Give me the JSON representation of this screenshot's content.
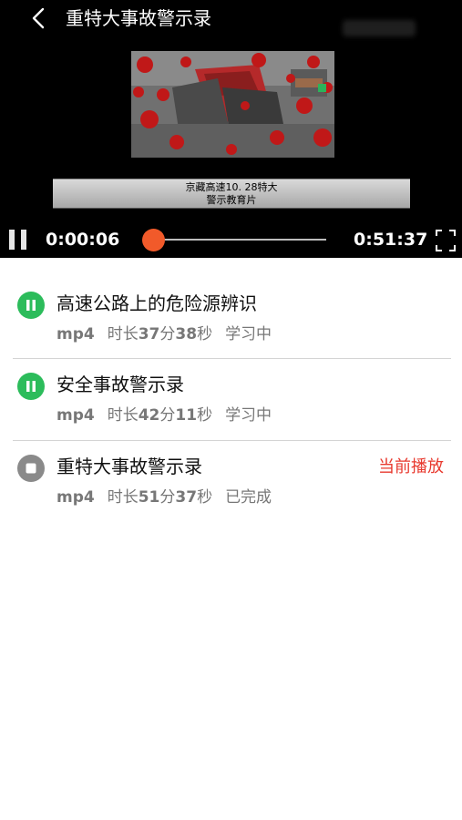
{
  "header": {
    "title": "重特大事故警示录",
    "back_icon": "chevron-left-icon"
  },
  "video": {
    "subtitle_line1": "京藏高速10. 28特大",
    "subtitle_line2": "警示教育片",
    "current_time": "0:00:06",
    "total_time": "0:51:37",
    "progress": 0.002,
    "accent_color": "#f15a2a"
  },
  "list": [
    {
      "title": "高速公路上的危险源辨识",
      "format": "mp4",
      "duration_prefix": "时长",
      "duration_min": "37",
      "min_unit": "分",
      "duration_sec": "38",
      "sec_unit": "秒",
      "status": "学习中",
      "icon": "pause-circle-icon",
      "icon_color": "#2cbc5b"
    },
    {
      "title": "安全事故警示录",
      "format": "mp4",
      "duration_prefix": "时长",
      "duration_min": "42",
      "min_unit": "分",
      "duration_sec": "11",
      "sec_unit": "秒",
      "status": "学习中",
      "icon": "pause-circle-icon",
      "icon_color": "#2cbc5b"
    },
    {
      "title": "重特大事故警示录",
      "format": "mp4",
      "duration_prefix": "时长",
      "duration_min": "51",
      "min_unit": "分",
      "duration_sec": "37",
      "sec_unit": "秒",
      "status": "已完成",
      "icon": "stop-circle-icon",
      "icon_color": "#8a8a8a",
      "current_label": "当前播放",
      "current_color": "#e8392e"
    }
  ]
}
